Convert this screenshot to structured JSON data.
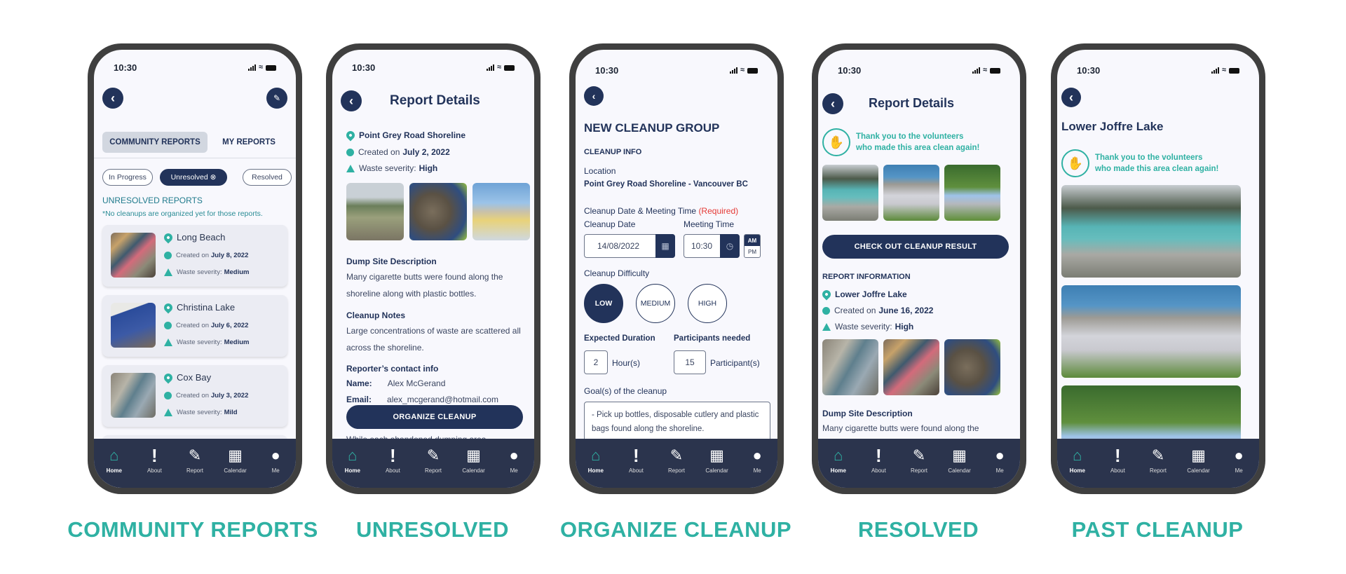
{
  "status_bar": {
    "time": "10:30"
  },
  "nav": [
    {
      "label": "Home",
      "icon": "home-icon"
    },
    {
      "label": "About",
      "icon": "exclamation-icon"
    },
    {
      "label": "Report",
      "icon": "report-edit-icon"
    },
    {
      "label": "Calendar",
      "icon": "calendar-icon"
    },
    {
      "label": "Me",
      "icon": "user-icon"
    }
  ],
  "captions": [
    "COMMUNITY REPORTS",
    "UNRESOLVED",
    "ORGANIZE CLEANUP",
    "RESOLVED",
    "PAST CLEANUP"
  ],
  "colors": {
    "primary": "#22335a",
    "accent": "#2fb1a3",
    "nav_bg": "#2b344d",
    "required": "#e53935"
  },
  "community": {
    "tabs": [
      "COMMUNITY REPORTS",
      "MY REPORTS"
    ],
    "active_tab": "COMMUNITY REPORTS",
    "filters": [
      "In Progress",
      "Unresolved",
      "Resolved"
    ],
    "active_filter": "Unresolved",
    "section_title": "UNRESOLVED REPORTS",
    "section_note": "*No cleanups are organized yet for those reports.",
    "created_prefix": "Created on",
    "severity_prefix": "Waste severity:",
    "reports": [
      {
        "name": "Long Beach",
        "date": "July 8, 2022",
        "severity": "Medium"
      },
      {
        "name": "Christina Lake",
        "date": "July 6, 2022",
        "severity": "Medium"
      },
      {
        "name": "Cox Bay",
        "date": "July 3, 2022",
        "severity": "Mild"
      }
    ]
  },
  "unresolved": {
    "title": "Report Details",
    "location": "Point Grey Road Shoreline",
    "created_prefix": "Created on",
    "date": "July 2, 2022",
    "severity_prefix": "Waste severity:",
    "severity": "High",
    "dump_heading": "Dump Site Description",
    "dump_text": "Many cigarette butts were found along the shoreline along with plastic bottles.",
    "notes_heading": "Cleanup Notes",
    "notes_text": "Large concentrations of waste are scattered all across the shoreline.",
    "contact_heading": "Reporter’s contact info",
    "name_label": "Name:",
    "name_value": "Alex McGerand",
    "email_label": "Email:",
    "email_value": "alex_mcgerand@hotmail.com",
    "trailing_text": "While each abandoned dumping area",
    "button": "ORGANIZE CLEANUP"
  },
  "organize": {
    "title": "NEW CLEANUP GROUP",
    "section": "CLEANUP INFO",
    "location_label": "Location",
    "location_value": "Point Grey Road Shoreline - Vancouver BC",
    "datetime_label": "Cleanup Date & Meeting Time",
    "required": "(Required)",
    "date_label": "Cleanup Date",
    "date_value": "14/08/2022",
    "time_label": "Meeting Time",
    "time_value": "10:30",
    "am": "AM",
    "pm": "PM",
    "difficulty_label": "Cleanup Difficulty",
    "difficulties": [
      "LOW",
      "MEDIUM",
      "HIGH"
    ],
    "difficulty_selected": "LOW",
    "duration_label": "Expected Duration",
    "duration_value": "2",
    "duration_unit": "Hour(s)",
    "participants_label": "Participants needed",
    "participants_value": "15",
    "participants_unit": "Participant(s)",
    "goal_label": "Goal(s) of the cleanup",
    "goal_text": "- Pick up bottles, disposable cutlery and plastic bags found along the shoreline.\n- Creating a fun environment for"
  },
  "resolved": {
    "title": "Report Details",
    "thanks_line1": "Thank you to the volunteers",
    "thanks_line2": "who made this area clean again!",
    "button": "CHECK OUT CLEANUP RESULT",
    "info_heading": "REPORT INFORMATION",
    "location": "Lower Joffre Lake",
    "created_prefix": "Created on",
    "date": "June 16, 2022",
    "severity_prefix": "Waste severity:",
    "severity": "High",
    "dump_heading": "Dump Site Description",
    "dump_text": "Many cigarette butts were found along the"
  },
  "past": {
    "title": "Lower Joffre Lake",
    "thanks_line1": "Thank you to the volunteers",
    "thanks_line2": "who made this area clean again!"
  }
}
